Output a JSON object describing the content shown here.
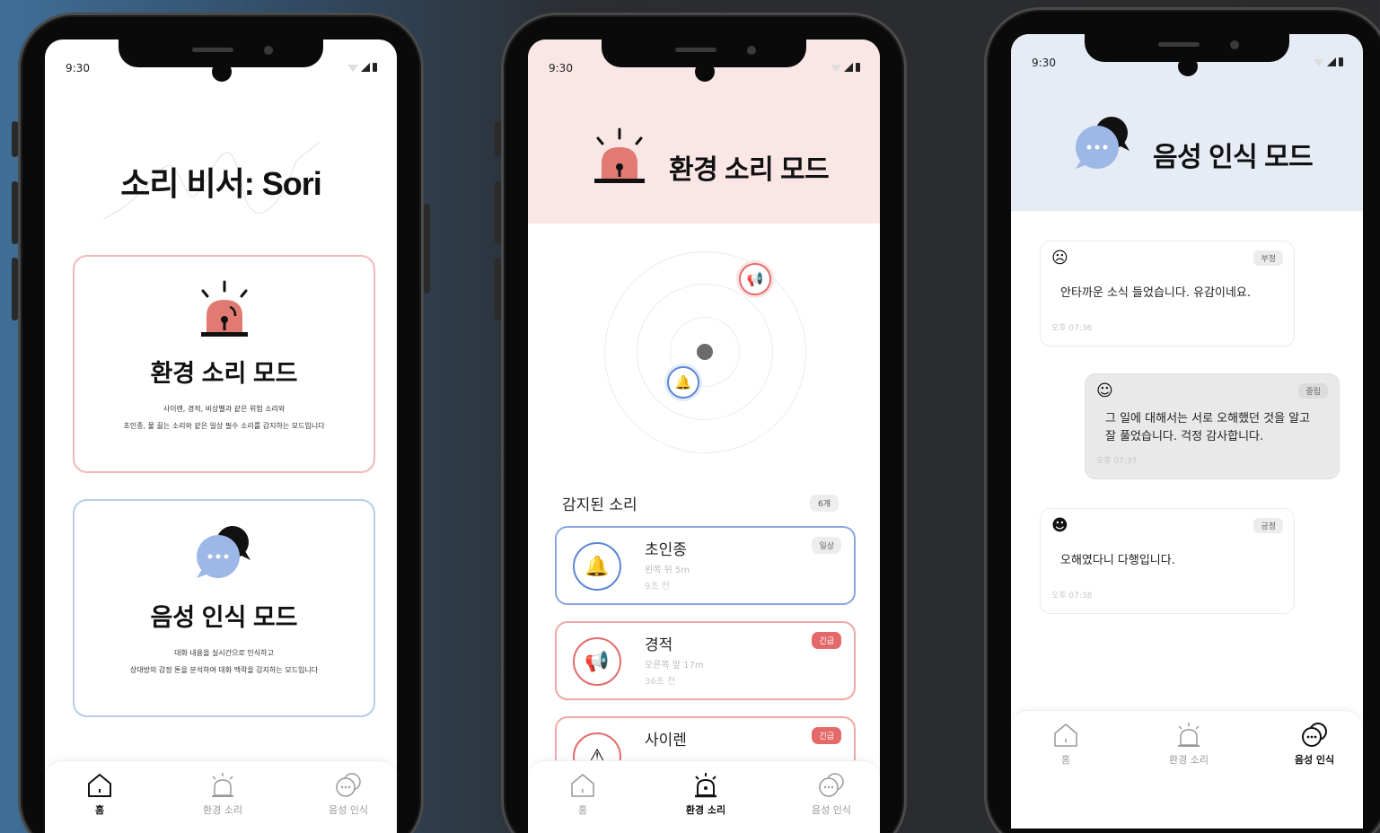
{
  "status": {
    "time": "9:30"
  },
  "phone1": {
    "title": "소리 비서: Sori",
    "env_card": {
      "title": "환경 소리 모드",
      "desc_line1": "사이렌, 경적, 비상벨과 같은 위험 소리와",
      "desc_line2": "초인종, 물 끓는 소리와 같은 일상 필수 소리를 감지하는 모드입니다"
    },
    "voice_card": {
      "title": "음성 인식 모드",
      "desc_line1": "대화 내용을 실시간으로 인식하고",
      "desc_line2": "상대방의 감정 톤을 분석하여 대화 맥락을 감지하는 모드입니다"
    }
  },
  "tabs": {
    "home": "홈",
    "env": "환경 소리",
    "voice": "음성 인식"
  },
  "phone2": {
    "header_title": "환경 소리 모드",
    "header_color": "#fbe6e6",
    "section_title": "감지된 소리",
    "count": "6개",
    "items": [
      {
        "name": "초인종",
        "direction": "왼쪽 뒤 5m",
        "time": "9초 전",
        "badge": "일상",
        "icon": "bell-icon"
      },
      {
        "name": "경적",
        "direction": "오른쪽 앞 17m",
        "time": "36초 전",
        "badge": "긴급",
        "icon": "horn-icon"
      },
      {
        "name": "사이렌",
        "direction": "",
        "time": "",
        "badge": "긴급",
        "icon": "warning-icon"
      }
    ]
  },
  "phone3": {
    "header_title": "음성 인식 모드",
    "header_color": "#e6ecf6",
    "messages": [
      {
        "emoji": "☹",
        "tag": "부정",
        "text": "안타까운 소식 들었습니다. 유감이네요.",
        "time": "오후 07:36"
      },
      {
        "emoji": "☺",
        "tag": "중립",
        "text": "그 일에 대해서는 서로 오해했던 것을 알고 잘 풀었습니다. 걱정 감사합니다.",
        "time": "오후 07:37"
      },
      {
        "emoji": "☻",
        "tag": "긍정",
        "text": "오해였다니 다행입니다.",
        "time": "오후 07:38"
      }
    ]
  },
  "colors": {
    "accent_red": "#e46a6a",
    "accent_blue": "#5a86d4"
  }
}
